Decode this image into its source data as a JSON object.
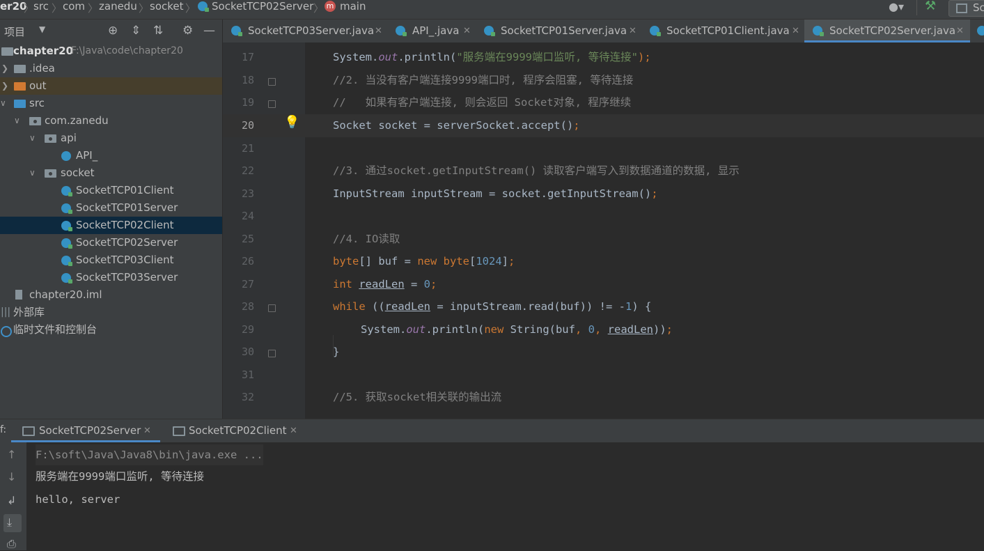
{
  "breadcrumb": {
    "items": [
      "er20",
      "src",
      "com",
      "zanedu",
      "socket",
      "SocketTCP02Server",
      "main"
    ],
    "method_icon_letter": "m"
  },
  "navbar_right": {
    "partial_label": "Sc"
  },
  "project_panel": {
    "title": "项目",
    "tree": [
      {
        "label": "chapter20",
        "path": "F:\\Java\\code\\chapter20"
      },
      {
        "label": ".idea"
      },
      {
        "label": "out"
      },
      {
        "label": "src"
      },
      {
        "label": "com.zanedu"
      },
      {
        "label": "api"
      },
      {
        "label": "API_"
      },
      {
        "label": "socket"
      },
      {
        "label": "SocketTCP01Client"
      },
      {
        "label": "SocketTCP01Server"
      },
      {
        "label": "SocketTCP02Client"
      },
      {
        "label": "SocketTCP02Server"
      },
      {
        "label": "SocketTCP03Client"
      },
      {
        "label": "SocketTCP03Server"
      },
      {
        "label": "chapter20.iml"
      },
      {
        "label": "外部库"
      },
      {
        "label": "临时文件和控制台"
      }
    ]
  },
  "editor_tabs": [
    {
      "label": "SocketTCP03Server.java"
    },
    {
      "label": "API_.java"
    },
    {
      "label": "SocketTCP01Server.java"
    },
    {
      "label": "SocketTCP01Client.java"
    },
    {
      "label": "SocketTCP02Server.java",
      "active": true
    }
  ],
  "editor": {
    "line_numbers": [
      "17",
      "18",
      "19",
      "20",
      "21",
      "22",
      "23",
      "24",
      "25",
      "26",
      "27",
      "28",
      "29",
      "30",
      "31",
      "32"
    ],
    "current_line": "20",
    "code": {
      "l17": {
        "a": "System.",
        "b": "out",
        "c": ".println(",
        "d": "\"服务端在9999端口监听, 等待连接\"",
        "e": ");"
      },
      "l18": "//2. 当没有客户端连接9999端口时, 程序会阻塞, 等待连接",
      "l19": "//   如果有客户端连接, 则会返回 Socket对象, 程序继续",
      "l20": {
        "a": "Socket socket = serverSocket.accept()",
        "b": ";"
      },
      "l22": "//3. 通过socket.getInputStream() 读取客户端写入到数据通道的数据, 显示",
      "l23": {
        "a": "InputStream inputStream = socket.getInputStream()",
        "b": ";"
      },
      "l25": "//4. IO读取",
      "l26": {
        "a": "byte",
        "b": "[] buf = ",
        "c": "new ",
        "d": "byte",
        "e": "[",
        "f": "1024",
        "g": "]",
        "h": ";"
      },
      "l27": {
        "a": "int ",
        "b": "readLen",
        "c": " = ",
        "d": "0",
        "e": ";"
      },
      "l28": {
        "a": "while ",
        "b": "((",
        "c": "readLen",
        "d": " = inputStream.read(buf)) != -",
        "e": "1",
        "f": ") {"
      },
      "l29": {
        "a": "System.",
        "b": "out",
        "c": ".println(",
        "d": "new ",
        "e": "String(buf",
        "f": ", ",
        "g": "0",
        "h": ", ",
        "i": "readLen",
        "j": "))",
        "k": ";"
      },
      "l30": "}",
      "l32": "//5. 获取socket相关联的输出流"
    }
  },
  "run_panel": {
    "prefix": "f:",
    "tabs": [
      {
        "label": "SocketTCP02Server",
        "active": true
      },
      {
        "label": "SocketTCP02Client"
      }
    ],
    "console": [
      "F:\\soft\\Java\\Java8\\bin\\java.exe ...",
      "服务端在9999端口监听, 等待连接",
      "hello, server"
    ]
  },
  "colors": {
    "keyword": "#cc7832",
    "string": "#6a8759",
    "comment": "#808080",
    "number": "#6897bb",
    "static_field": "#9876aa",
    "accent": "#4a88c7",
    "selection": "#0d293e"
  },
  "icons": [
    "user-icon",
    "hammer-icon",
    "run-config-icon",
    "target-icon",
    "expand-all-icon",
    "collapse-all-icon",
    "gear-icon",
    "minimize-icon",
    "lightbulb-icon",
    "up-arrow-icon",
    "down-arrow-icon",
    "soft-wrap-icon",
    "scroll-to-end-icon",
    "print-icon"
  ]
}
